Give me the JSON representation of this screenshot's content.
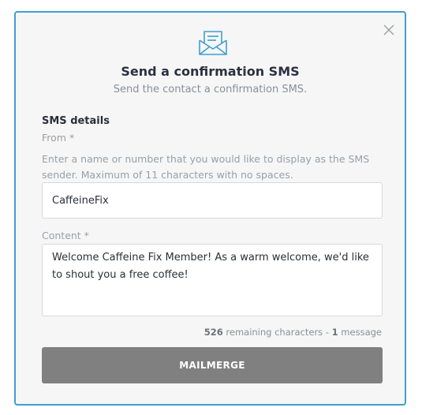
{
  "modal": {
    "title": "Send a confirmation SMS",
    "subtitle": "Send the contact a confirmation SMS."
  },
  "form": {
    "section_title": "SMS details",
    "from_label": "From *",
    "from_help": "Enter a name or number that you would like to display as the SMS sender. Maximum of 11 characters with no spaces.",
    "from_value": "CaffeineFix",
    "content_label": "Content *",
    "content_value": "Welcome Caffeine Fix Member! As a warm welcome, we'd like to shout you a free coffee!",
    "remaining_count": "526",
    "remaining_text": " remaining characters - ",
    "message_count": "1",
    "message_text": " message"
  },
  "buttons": {
    "mailmerge_label": "MAILMERGE"
  },
  "icons": {
    "close": "close-icon",
    "header": "envelope-message-icon"
  },
  "colors": {
    "accent": "#3f9fcf",
    "button_bg": "#808080"
  }
}
